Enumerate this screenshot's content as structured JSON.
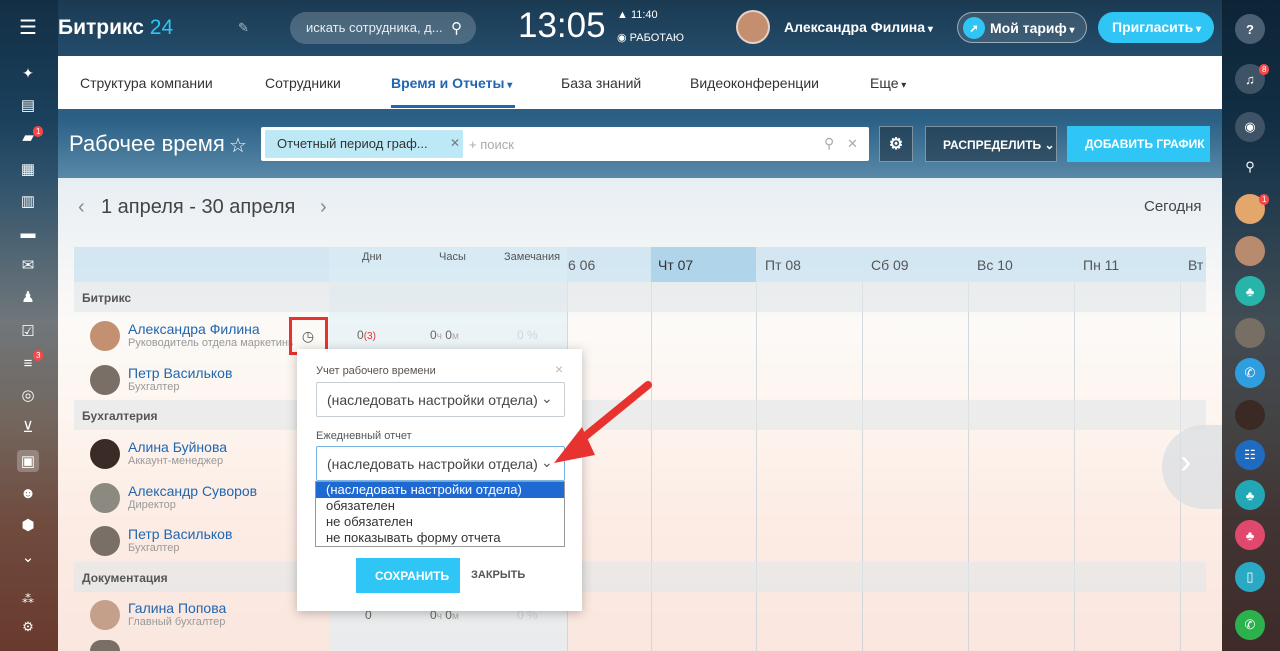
{
  "header": {
    "logo_main": "Битрикс",
    "logo_num": "24",
    "search_placeholder": "искать сотрудника, д...",
    "clock": "13:05",
    "alarm_time": "11:40",
    "work_status": "РАБОТАЮ",
    "user_name": "Александра Филина",
    "tariff_label": "Мой тариф",
    "invite_label": "Пригласить"
  },
  "leftbar": {
    "chat_badge": "1",
    "tasks_badge": "3"
  },
  "rightbar": {
    "notify_badge": "8",
    "avatar_badge": "1"
  },
  "nav": {
    "items": [
      "Структура компании",
      "Сотрудники",
      "Время и Отчеты",
      "База знаний",
      "Видеоконференции",
      "Еще"
    ]
  },
  "toolbar": {
    "page_title": "Рабочее время",
    "filter_tag": "Отчетный период граф...",
    "filter_placeholder": "+ поиск",
    "distribute_label": "РАСПРЕДЕЛИТЬ",
    "add_schedule_label": "ДОБАВИТЬ ГРАФИК"
  },
  "calendar": {
    "period": "1 апреля - 30 апреля",
    "today_label": "Сегодня",
    "stat_headers": [
      "Дни",
      "Часы",
      "Замечания"
    ],
    "day_headers": [
      "6 06",
      "Чт 07",
      "Пт 08",
      "Сб 09",
      "Вс 10",
      "Пн 11",
      "Вт"
    ]
  },
  "departments": [
    {
      "name": "Битрикс",
      "employees": [
        {
          "name": "Александра Филина",
          "position": "Руководитель отдела маркетинга",
          "days": "0",
          "days_note": "(3)",
          "hours_h": "0",
          "hours_h_unit": "ч",
          "hours_m": "0",
          "hours_m_unit": "м",
          "remarks": "0 %"
        },
        {
          "name": "Петр Васильков",
          "position": "Бухгалтер"
        }
      ]
    },
    {
      "name": "Бухгалтерия",
      "employees": [
        {
          "name": "Алина Буйнова",
          "position": "Аккаунт-менеджер"
        },
        {
          "name": "Александр Суворов",
          "position": "Директор"
        },
        {
          "name": "Петр Васильков",
          "position": "Бухгалтер"
        }
      ]
    },
    {
      "name": "Документация",
      "employees": [
        {
          "name": "Галина Попова",
          "position": "Главный бухгалтер",
          "days": "0",
          "hours_h": "0",
          "hours_h_unit": "ч",
          "hours_m": "0",
          "hours_m_unit": "м",
          "remarks": "0 %"
        }
      ]
    }
  ],
  "popup": {
    "worktime_label": "Учет рабочего времени",
    "worktime_value": "(наследовать настройки отдела)",
    "report_label": "Ежедневный отчет",
    "report_value": "(наследовать настройки отдела)",
    "report_options": [
      "(наследовать настройки отдела)",
      "обязателен",
      "не обязателен",
      "не показывать форму отчета"
    ],
    "close_x": "×",
    "save_label": "СОХРАНИТЬ",
    "close_label": "ЗАКРЫТЬ"
  },
  "colors": {
    "accent": "#2fc6f6",
    "annotation_red": "#e8322f",
    "link": "#2066b0"
  }
}
